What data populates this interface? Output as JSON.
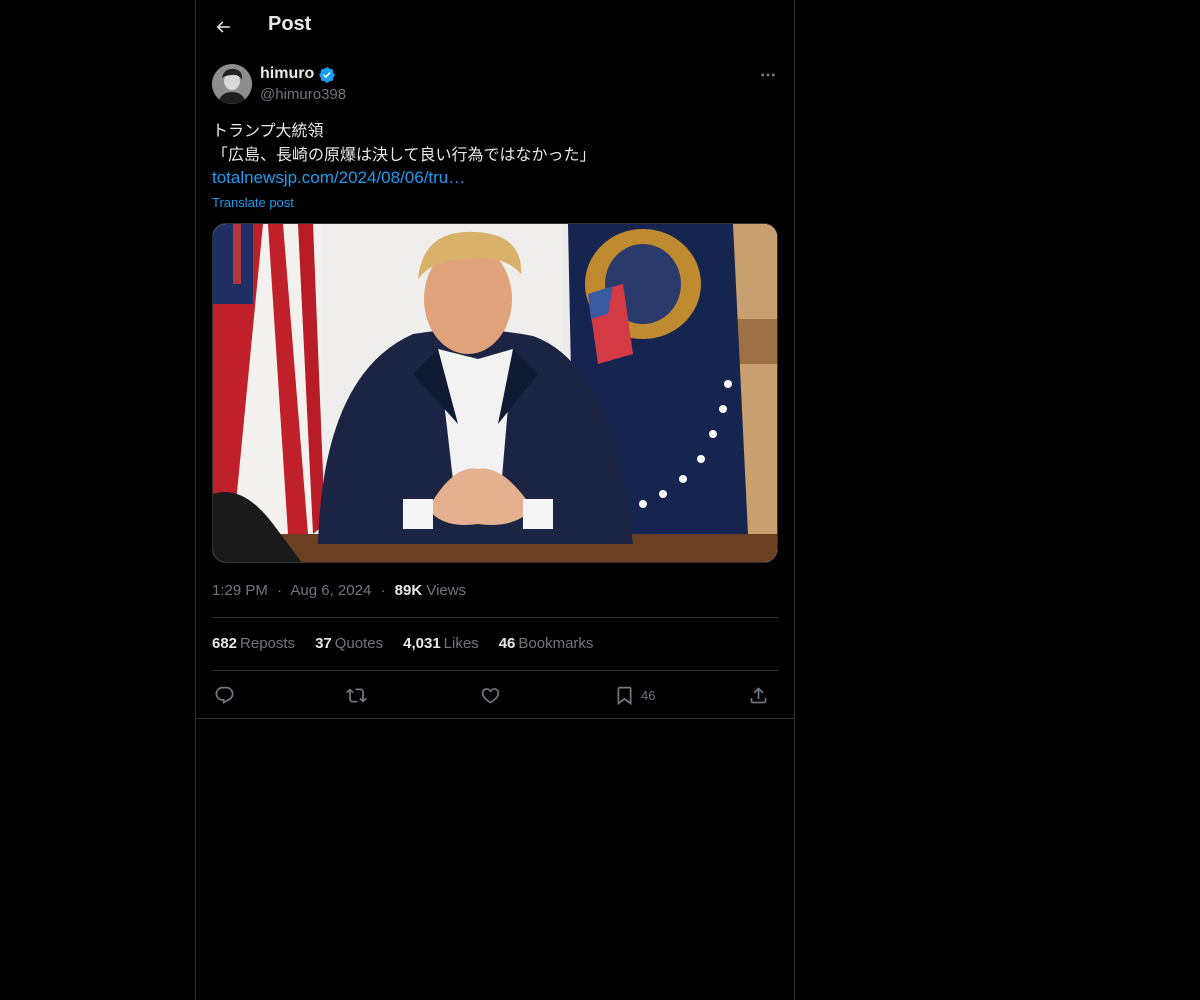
{
  "header": {
    "title": "Post"
  },
  "author": {
    "name": "himuro",
    "handle": "@himuro398"
  },
  "post": {
    "lines": [
      "トランプ大統領",
      "「広島、長崎の原爆は決して良い行為ではなかった」"
    ],
    "link": "totalnewsjp.com/2024/08/06/tru…",
    "translate": "Translate post"
  },
  "meta": {
    "time": "1:29 PM",
    "sep": "·",
    "date": "Aug 6, 2024",
    "views_count": "89K",
    "views_label": "Views"
  },
  "stats": {
    "reposts_count": "682",
    "reposts_label": "Reposts",
    "quotes_count": "37",
    "quotes_label": "Quotes",
    "likes_count": "4,031",
    "likes_label": "Likes",
    "bookmarks_count": "46",
    "bookmarks_label": "Bookmarks"
  },
  "actions": {
    "bookmark_count": "46"
  },
  "icons": [
    "back-arrow-icon",
    "verified-badge-icon",
    "more-icon",
    "reply-icon",
    "repost-icon",
    "like-icon",
    "bookmark-icon",
    "share-icon"
  ],
  "colors": {
    "background": "#000000",
    "text": "#e7e9ea",
    "muted": "#71767b",
    "accent": "#1d9bf0",
    "border": "#2f3336"
  }
}
